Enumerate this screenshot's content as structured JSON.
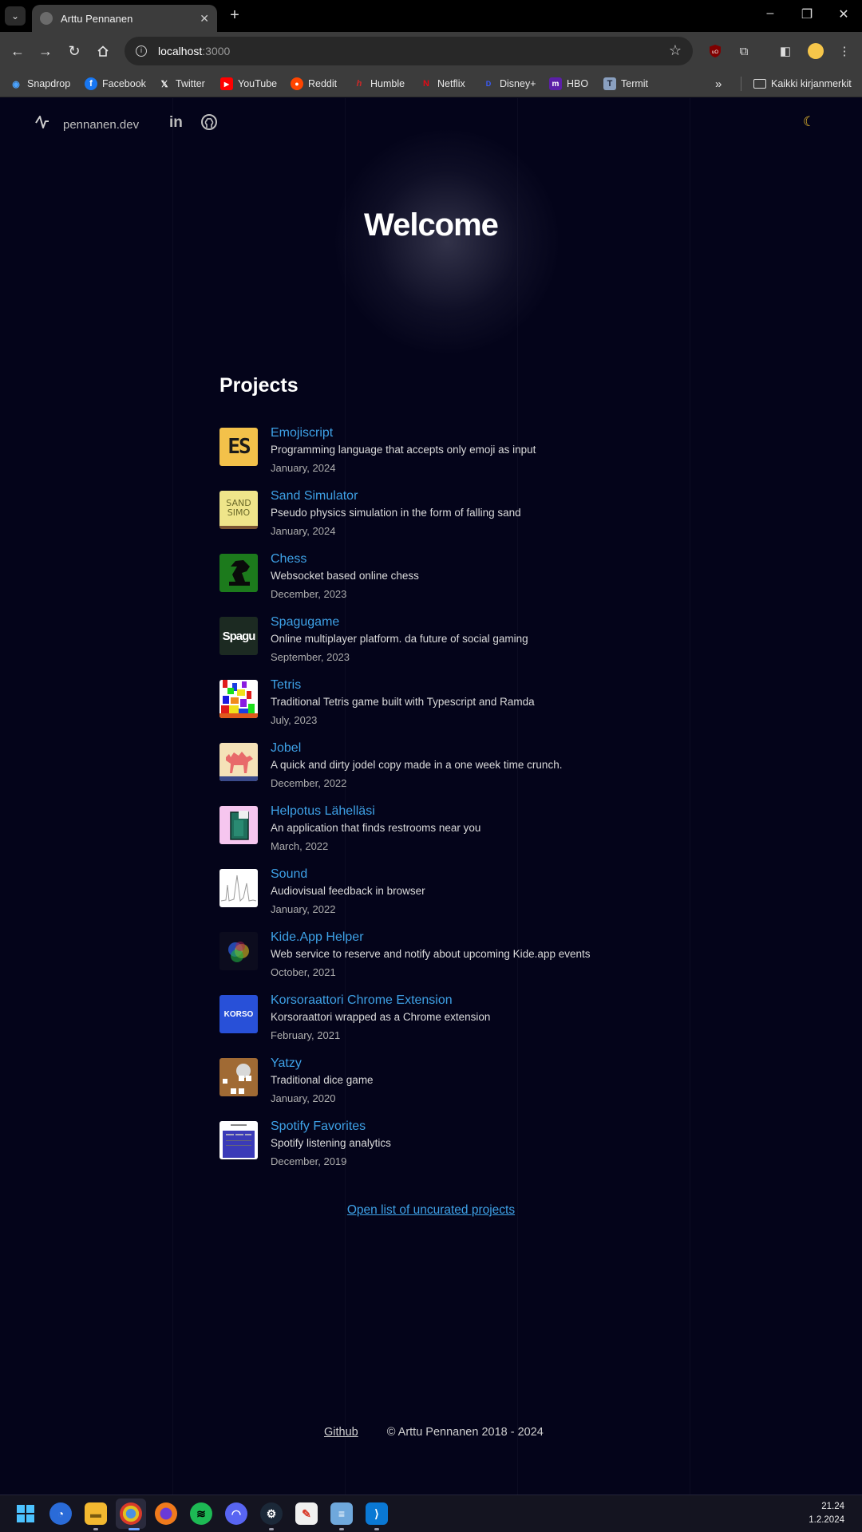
{
  "browser": {
    "tab_title": "Arttu Pennanen",
    "url_host": "localhost",
    "url_port": ":3000",
    "bookmarks": [
      {
        "label": "Snapdrop",
        "icon": "snapdrop-icon",
        "color": "#4aa3ff"
      },
      {
        "label": "Facebook",
        "icon": "facebook-icon",
        "color": "#1877f2"
      },
      {
        "label": "Twitter",
        "icon": "x-icon",
        "color": "#ffffff"
      },
      {
        "label": "YouTube",
        "icon": "youtube-icon",
        "color": "#ff0000"
      },
      {
        "label": "Reddit",
        "icon": "reddit-icon",
        "color": "#ff4500"
      },
      {
        "label": "Humble",
        "icon": "humble-icon",
        "color": "#cc2929"
      },
      {
        "label": "Netflix",
        "icon": "netflix-icon",
        "color": "#e50914"
      },
      {
        "label": "Disney+",
        "icon": "disney-icon",
        "color": "#113ccf"
      },
      {
        "label": "HBO",
        "icon": "hbo-icon",
        "color": "#5b1fa8"
      },
      {
        "label": "Termit",
        "icon": "termit-icon",
        "color": "#8aa0c0"
      }
    ],
    "all_bookmarks": "Kaikki kirjanmerkit"
  },
  "site": {
    "logo_text": "pennanen.dev",
    "accent": "#3ea1e6",
    "hero_title": "Welcome",
    "projects_title": "Projects",
    "projects": [
      {
        "name": "Emojiscript",
        "desc": "Programming language that accepts only emoji as input",
        "date": "January, 2024",
        "thumb": "emojiscript"
      },
      {
        "name": "Sand Simulator",
        "desc": "Pseudo physics simulation in the form of falling sand",
        "date": "January, 2024",
        "thumb": "sand"
      },
      {
        "name": "Chess",
        "desc": "Websocket based online chess",
        "date": "December, 2023",
        "thumb": "chess"
      },
      {
        "name": "Spagugame",
        "desc": "Online multiplayer platform. da future of social gaming",
        "date": "September, 2023",
        "thumb": "spagu"
      },
      {
        "name": "Tetris",
        "desc": "Traditional Tetris game built with Typescript and Ramda",
        "date": "July, 2023",
        "thumb": "tetris"
      },
      {
        "name": "Jobel",
        "desc": "A quick and dirty jodel copy made in a one week time crunch.",
        "date": "December, 2022",
        "thumb": "jobel"
      },
      {
        "name": "Helpotus Lähelläsi",
        "desc": "An application that finds restrooms near you",
        "date": "March, 2022",
        "thumb": "helpotus"
      },
      {
        "name": "Sound",
        "desc": "Audiovisual feedback in browser",
        "date": "January, 2022",
        "thumb": "sound"
      },
      {
        "name": "Kide.App Helper",
        "desc": "Web service to reserve and notify about upcoming Kide.app events",
        "date": "October, 2021",
        "thumb": "kide"
      },
      {
        "name": "Korsoraattori Chrome Extension",
        "desc": "Korsoraattori wrapped as a Chrome extension",
        "date": "February, 2021",
        "thumb": "korso"
      },
      {
        "name": "Yatzy",
        "desc": "Traditional dice game",
        "date": "January, 2020",
        "thumb": "yatzy"
      },
      {
        "name": "Spotify Favorites",
        "desc": "Spotify listening analytics",
        "date": "December, 2019",
        "thumb": "spotify"
      }
    ],
    "thumb_labels": {
      "emojiscript": "ES",
      "sand": "SAND SIMO",
      "spagu": "Spagu",
      "korso": "KORSO"
    },
    "uncurated_link": "Open list of uncurated projects",
    "footer_link": "Github",
    "footer_copy": "© Arttu Pennanen 2018 - 2024"
  },
  "taskbar": {
    "apps": [
      "start-icon",
      "copilot-icon",
      "file-explorer-icon",
      "chrome-icon",
      "firefox-icon",
      "spotify-icon",
      "discord-icon",
      "steam-icon",
      "paint-icon",
      "notepad-icon",
      "vscode-icon"
    ],
    "time": "21.24",
    "date": "1.2.2024"
  }
}
